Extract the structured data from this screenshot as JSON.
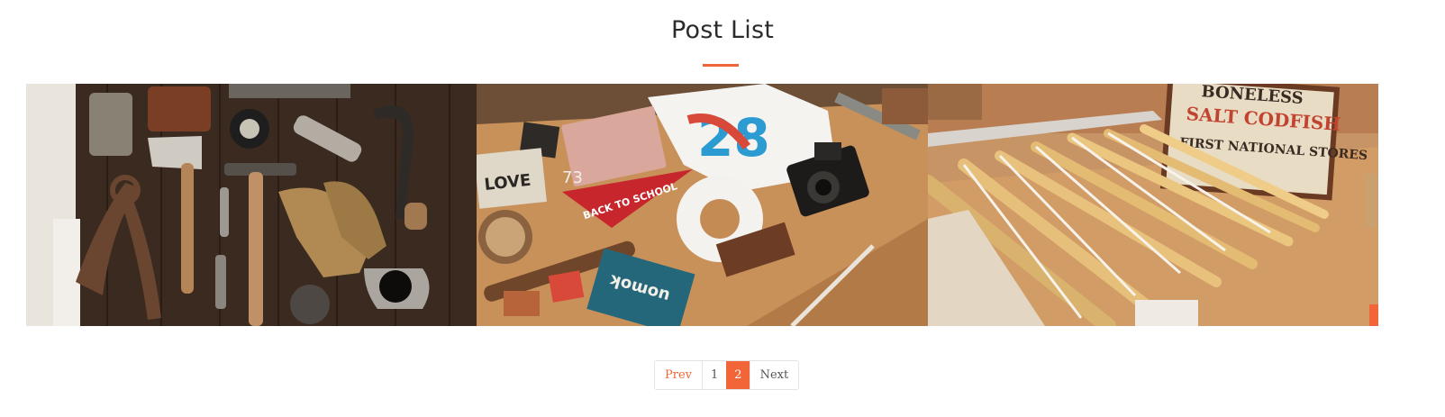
{
  "section": {
    "title": "Post List",
    "accent_color": "#f26539"
  },
  "posts": [
    {
      "image": "tools-on-wooden-table"
    },
    {
      "image": "design-desk-flatlay"
    },
    {
      "image": "folding-rulers-on-workbench"
    }
  ],
  "artwork_text": {
    "flatlay_card": "LOVE",
    "flatlay_pennant": "BACK TO SCHOOL",
    "flatlay_number": "73",
    "flatlay_tshirt": "28",
    "flatlay_book": "uomok",
    "box_line1": "BONELESS",
    "box_line2": "SALT CODFISH",
    "box_line3": "FIRST NATIONAL STORES"
  },
  "pagination": {
    "prev": "Prev",
    "pages": [
      "1",
      "2"
    ],
    "active_page": "2",
    "next": "Next"
  }
}
